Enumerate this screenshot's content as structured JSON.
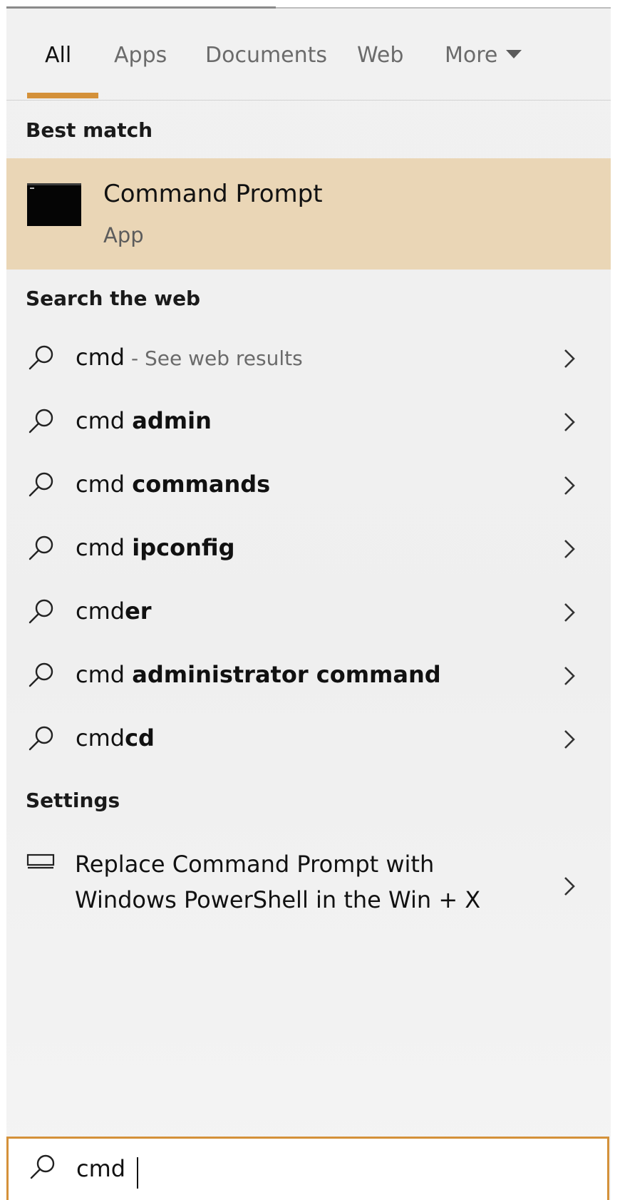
{
  "tabs": [
    {
      "label": "All",
      "active": true
    },
    {
      "label": "Apps",
      "active": false
    },
    {
      "label": "Documents",
      "active": false
    },
    {
      "label": "Web",
      "active": false
    },
    {
      "label": "More",
      "active": false
    }
  ],
  "best_match": {
    "section_label": "Best match",
    "title": "Command Prompt",
    "subtitle": "App",
    "icon": "command-prompt-icon"
  },
  "web": {
    "section_label": "Search the web",
    "items": [
      {
        "prefix": "cmd",
        "bold": "",
        "hint": " - See web results"
      },
      {
        "prefix": "cmd ",
        "bold": "admin",
        "hint": ""
      },
      {
        "prefix": "cmd ",
        "bold": "commands",
        "hint": ""
      },
      {
        "prefix": "cmd ",
        "bold": "ipconfig",
        "hint": ""
      },
      {
        "prefix": "cmd",
        "bold": "er",
        "hint": ""
      },
      {
        "prefix": "cmd ",
        "bold": "administrator command",
        "hint": ""
      },
      {
        "prefix": "cmd",
        "bold": "cd",
        "hint": ""
      }
    ]
  },
  "settings": {
    "section_label": "Settings",
    "line1": "Replace Command Prompt with",
    "line2": "Windows PowerShell in the Win + X",
    "icon": "monitor-icon"
  },
  "search": {
    "value": "cmd",
    "icon": "search-icon"
  },
  "colors": {
    "accent": "#d4913a",
    "best_match_bg": "#ead6b6",
    "panel_bg": "#f0f0f0"
  }
}
